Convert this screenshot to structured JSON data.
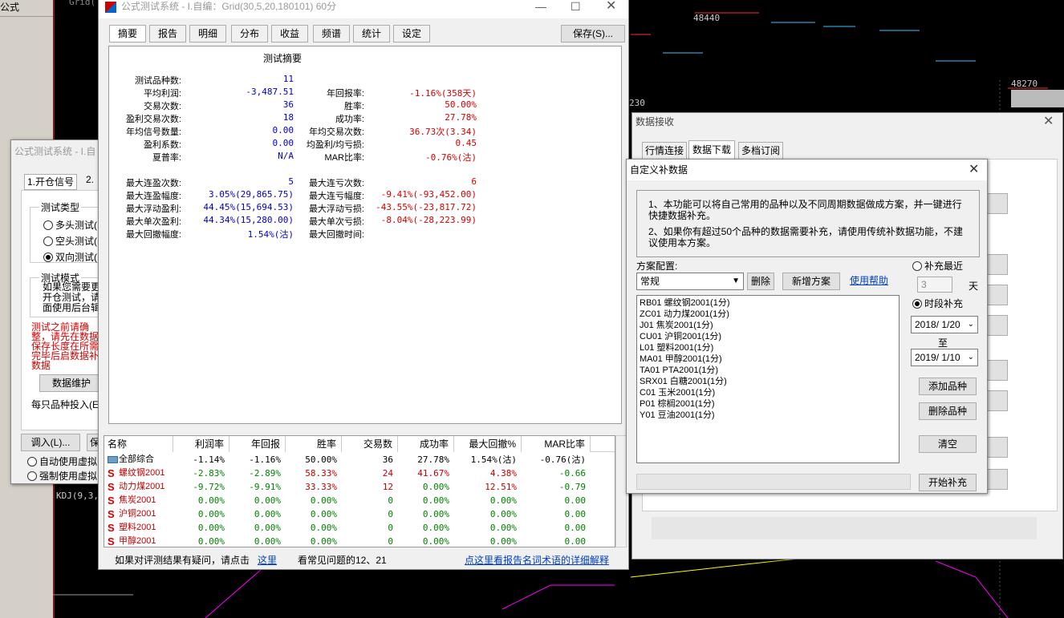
{
  "bg": {
    "top_left_menu": "公式",
    "chart_label_1": "48440",
    "chart_label_2": "48270",
    "chart_label_3": "230",
    "kdj_label": "KDJ(9,3,",
    "chart_grid_text": "Grid("
  },
  "main_window": {
    "title": "公式测试系统 - I.自编：Grid(30,5,20,180101) 60分",
    "tabs": [
      "摘要",
      "报告",
      "明细",
      "分布",
      "收益",
      "频谱",
      "统计",
      "设定"
    ],
    "save_button": "保存(S)...",
    "summary_title": "测试摘要",
    "left_stats": [
      {
        "label": "测试品种数:",
        "value": "11"
      },
      {
        "label": "平均利润:",
        "value": "-3,487.51"
      },
      {
        "label": "交易次数:",
        "value": "36"
      },
      {
        "label": "盈利交易次数:",
        "value": "18"
      },
      {
        "label": "年均信号数量:",
        "value": "0.00"
      },
      {
        "label": "盈利系数:",
        "value": "0.00"
      },
      {
        "label": "夏普率:",
        "value": "N/A"
      }
    ],
    "right_stats": [
      {
        "label": "年回报率:",
        "value": "-1.16%(358天)"
      },
      {
        "label": "胜率:",
        "value": "50.00%"
      },
      {
        "label": "成功率:",
        "value": "27.78%"
      },
      {
        "label": "年均交易次数:",
        "value": "36.73次(3.34)"
      },
      {
        "label": "均盈利/均亏损:",
        "value": "0.45"
      },
      {
        "label": "MAR比率:",
        "value": "-0.76%(沽)"
      }
    ],
    "left_stats2": [
      {
        "label": "最大连盈次数:",
        "value": "5"
      },
      {
        "label": "最大连盈幅度:",
        "value": "3.05%(29,865.75)"
      },
      {
        "label": "最大浮动盈利:",
        "value": "44.45%(15,694.53)"
      },
      {
        "label": "最大单次盈利:",
        "value": "44.34%(15,280.00)"
      },
      {
        "label": "最大回撤幅度:",
        "value": "1.54%(沽)"
      }
    ],
    "right_stats2": [
      {
        "label": "最大连亏次数:",
        "value": "6"
      },
      {
        "label": "最大连亏幅度:",
        "value": "-9.41%(-93,452.00)"
      },
      {
        "label": "最大浮动亏损:",
        "value": "-43.55%(-23,817.72)"
      },
      {
        "label": "最大单次亏损:",
        "value": "-8.04%(-28,223.99)"
      },
      {
        "label": "最大回撤时间:",
        "value": ""
      }
    ],
    "table_headers": [
      "名称",
      "利润率",
      "年回报",
      "胜率",
      "交易数",
      "成功率",
      "最大回撤%",
      "MAR比率"
    ],
    "table_rows": [
      {
        "name": "全部综合",
        "icon": "folder",
        "cells": [
          "-1.14%",
          "-1.16%",
          "50.00%",
          "36",
          "27.78%",
          "1.54%(沽)",
          "-0.76(沽)"
        ]
      },
      {
        "name": "螺纹钢2001",
        "icon": "S",
        "cells": [
          "-2.83%",
          "-2.89%",
          "58.33%",
          "24",
          "41.67%",
          "4.38%",
          "-0.66"
        ]
      },
      {
        "name": "动力煤2001",
        "icon": "S",
        "cells": [
          "-9.72%",
          "-9.91%",
          "33.33%",
          "12",
          "0.00%",
          "12.51%",
          "-0.79"
        ]
      },
      {
        "name": "焦炭2001",
        "icon": "S",
        "cells": [
          "0.00%",
          "0.00%",
          "0.00%",
          "0",
          "0.00%",
          "0.00%",
          "0.00"
        ]
      },
      {
        "name": "沪铜2001",
        "icon": "S",
        "cells": [
          "0.00%",
          "0.00%",
          "0.00%",
          "0",
          "0.00%",
          "0.00%",
          "0.00"
        ]
      },
      {
        "name": "塑料2001",
        "icon": "S",
        "cells": [
          "0.00%",
          "0.00%",
          "0.00%",
          "0",
          "0.00%",
          "0.00%",
          "0.00"
        ]
      },
      {
        "name": "甲醇2001",
        "icon": "S",
        "cells": [
          "0.00%",
          "0.00%",
          "0.00%",
          "0",
          "0.00%",
          "0.00%",
          "0.00"
        ]
      }
    ],
    "footer_text": "如果对评测结果有疑问，请点击",
    "footer_link": "这里",
    "footer_text2": "看常见问题的12、21",
    "footer_link2": "点这里看报告名词术语的详细解释"
  },
  "back_window": {
    "title": "公式测试系统 - I.自",
    "tab1": "1.开仓信号",
    "tab2": "2.",
    "group_type": "测试类型",
    "radio1": "多头测试(",
    "radio2": "空头测试(",
    "radio3": "双向测试(",
    "group_mode": "测试模式",
    "mode_text": "如果您需要更开仓测试，请面使用后台辑",
    "warning_text": "测试之前请确整，请先在数据保存长度在所需完毕后启数据补数据",
    "data_btn": "数据维护",
    "invest_text": "每只品种投入(E",
    "import_btn": "调入(L)...",
    "save_btn": "保",
    "auto_radio": "自动使用虚拟",
    "force_radio": "强制使用虚拟"
  },
  "data_recv": {
    "title": "数据接收",
    "tabs": [
      "行情连接",
      "数据下载",
      "多档订阅"
    ]
  },
  "custom_dialog": {
    "title": "自定义补数据",
    "info1": "1、本功能可以将自己常用的品种以及不同周期数据做成方案，并一键进行快捷数据补充。",
    "info2": "2、如果你有超过50个品种的数据需要补充，请使用传统补数据功能，不建议使用本方案。",
    "plan_label": "方案配置:",
    "plan_value": "常规",
    "delete_btn": "删除",
    "new_plan_btn": "新增方案",
    "help_link": "使用帮助",
    "items": [
      "RB01 螺纹钢2001(1分)",
      "ZC01 动力煤2001(1分)",
      "J01 焦炭2001(1分)",
      "CU01 沪铜2001(1分)",
      "L01 塑料2001(1分)",
      "MA01 甲醇2001(1分)",
      "TA01 PTA2001(1分)",
      "SRX01 白糖2001(1分)",
      "C01 玉米2001(1分)",
      "P01 棕榈2001(1分)",
      "Y01 豆油2001(1分)"
    ],
    "radio_recent": "补充最近",
    "days_value": "3",
    "days_unit": "天",
    "radio_period": "时段补充",
    "date_from": "2018/ 1/20",
    "to_label": "至",
    "date_to": "2019/ 1/10",
    "add_btn": "添加品种",
    "remove_btn": "删除品种",
    "clear_btn": "清空",
    "start_btn": "开始补充"
  }
}
